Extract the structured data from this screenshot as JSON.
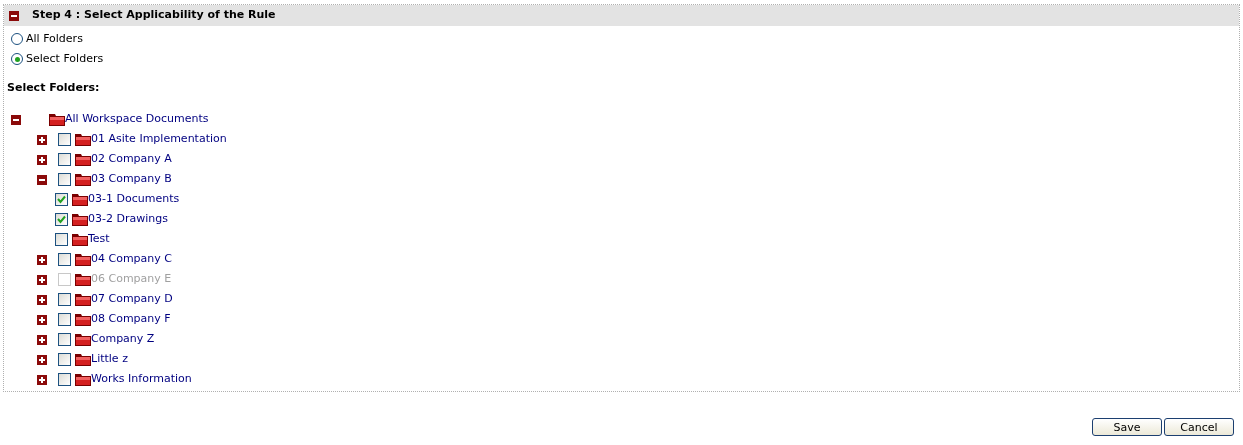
{
  "step": {
    "title": "Step 4 : Select Applicability of the Rule",
    "expanded": true
  },
  "scope_options": [
    {
      "label": "All Folders",
      "selected": false
    },
    {
      "label": "Select Folders",
      "selected": true
    }
  ],
  "folders_heading": "Select Folders:",
  "tree": {
    "name": "All Workspace Documents",
    "expanded": true,
    "children": [
      {
        "name": "01 Asite Implementation",
        "expanded": false,
        "checked": false,
        "disabled": false
      },
      {
        "name": "02 Company A",
        "expanded": false,
        "checked": false,
        "disabled": false
      },
      {
        "name": "03 Company B",
        "expanded": true,
        "checked": false,
        "disabled": false,
        "children": [
          {
            "name": "03-1 Documents",
            "checked": true,
            "disabled": false
          },
          {
            "name": "03-2 Drawings",
            "checked": true,
            "disabled": false
          },
          {
            "name": "Test",
            "checked": false,
            "disabled": false
          }
        ]
      },
      {
        "name": "04 Company C",
        "expanded": false,
        "checked": false,
        "disabled": false
      },
      {
        "name": "06 Company E",
        "expanded": false,
        "checked": false,
        "disabled": true
      },
      {
        "name": "07 Company D",
        "expanded": false,
        "checked": false,
        "disabled": false
      },
      {
        "name": "08 Company F",
        "expanded": false,
        "checked": false,
        "disabled": false
      },
      {
        "name": "Company Z",
        "expanded": false,
        "checked": false,
        "disabled": false
      },
      {
        "name": "Little z",
        "expanded": false,
        "checked": false,
        "disabled": false
      },
      {
        "name": "Works Information",
        "expanded": false,
        "checked": false,
        "disabled": false
      }
    ]
  },
  "buttons": [
    "Save",
    "Cancel"
  ]
}
